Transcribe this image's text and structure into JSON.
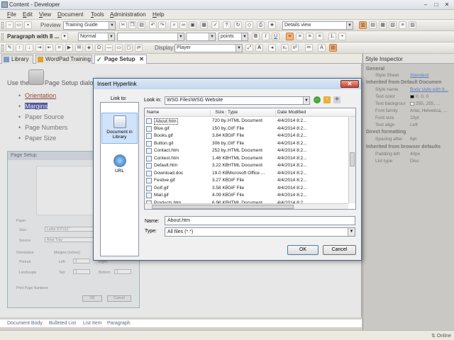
{
  "app": {
    "title": "Content - Developer",
    "window_controls": [
      "–",
      "□",
      "✕"
    ]
  },
  "menu": [
    "File",
    "Edit",
    "View",
    "Document",
    "Tools",
    "Administration",
    "Help"
  ],
  "toolbar1": {
    "preview_label": "Preview",
    "template": "Training Guide",
    "view": "Details view"
  },
  "toolbar2": {
    "style": "Paragraph with 8 ...",
    "font": "Normal",
    "size_units": "points"
  },
  "toolbar3": {
    "display_label": "Display:",
    "display_value": "Player"
  },
  "tabs": [
    {
      "label": "Library"
    },
    {
      "label": "WordPad Training"
    },
    {
      "label": "Page Setup"
    }
  ],
  "document": {
    "intro_left": "Use the",
    "intro_right": "Page Setup dialog",
    "bullets": [
      "Orientation",
      "Margins",
      "Paper Source",
      "Page Numbers",
      "Paper Size"
    ],
    "page_setup": {
      "title": "Page Setup",
      "paper_label": "Paper",
      "size_label": "Size:",
      "size_value": "Letter 8.5\"x11\"",
      "source_label": "Source:",
      "source_value": "Rear Tray",
      "orientation_label": "Orientation",
      "portrait": "Portrait",
      "landscape": "Landscape",
      "margins_label": "Margins (inches)",
      "left": "Left:",
      "right": "Right:",
      "top": "Top:",
      "bottom": "Bottom:",
      "one": "1",
      "print_numbers": "Print Page Numbers",
      "ok": "OK",
      "cancel": "Cancel"
    }
  },
  "breadcrumbs": [
    "Document Body",
    "Bulleted List",
    "List Item",
    "Paragraph"
  ],
  "status": {
    "online": "Online"
  },
  "inspector": {
    "title": "Style Inspector",
    "general": "General",
    "style_sheet_k": "Style Sheet",
    "style_sheet_v": "Standard",
    "inherited_doc": "Inherited from Default Documen",
    "style_name_k": "Style name",
    "style_name_v": "Body style with 8...",
    "text_color_k": "Text color",
    "text_color_v": "0, 0, 0",
    "text_bg_k": "Text backgrour",
    "text_bg_v": "255, 255, ...",
    "font_family_k": "Font family",
    "font_family_v": "Arial, Helvetica, ...",
    "font_size_k": "Font size",
    "font_size_v": "10pt",
    "text_align_k": "Text align",
    "text_align_v": "Left",
    "direct": "Direct formatting",
    "spacing_after_k": "Spacing after",
    "spacing_after_v": "6pt",
    "inherited_browser": "Inherited from browser defaults",
    "padding_left_k": "Padding left",
    "padding_left_v": "40px",
    "list_type_k": "List type",
    "list_type_v": "Disc"
  },
  "dialog": {
    "title": "Insert Hyperlink",
    "close": "✕",
    "link_to": "Link to:",
    "look_in_label": "Look in:",
    "look_in_value": "WSG Files\\WSG Website",
    "places": [
      {
        "label": "Document in Library"
      },
      {
        "label": "URL"
      }
    ],
    "columns": {
      "name": "Name",
      "size": "Size",
      "type": "Type",
      "date": "Date Modified"
    },
    "files": [
      {
        "name": "About.htm",
        "size": "720 by...",
        "type": "HTML Document",
        "date": "4/4/2014 8:2..."
      },
      {
        "name": "Blue.gif",
        "size": "150 by...",
        "type": "GIF File",
        "date": "4/4/2014 8:2..."
      },
      {
        "name": "Books.gif",
        "size": "3.84 KB",
        "type": "GIF File",
        "date": "4/4/2014 8:2..."
      },
      {
        "name": "Button.gif",
        "size": "306 by...",
        "type": "GIF File",
        "date": "4/4/2014 8:2..."
      },
      {
        "name": "Contact.htm",
        "size": "252 by...",
        "type": "HTML Document",
        "date": "4/4/2014 8:2..."
      },
      {
        "name": "Contest.htm",
        "size": "1.46 KB",
        "type": "HTML Document",
        "date": "4/4/2014 8:2..."
      },
      {
        "name": "Default.htm",
        "size": "3.22 KB",
        "type": "HTML Document",
        "date": "4/4/2014 8:2..."
      },
      {
        "name": "Download.doc",
        "size": "19.0 KB",
        "type": "Microsoft Office ...",
        "date": "4/4/2014 8:2..."
      },
      {
        "name": "Festive.gif",
        "size": "3.27 KB",
        "type": "GIF File",
        "date": "4/4/2014 8:2..."
      },
      {
        "name": "Golf.gif",
        "size": "3.58 KB",
        "type": "GIF File",
        "date": "4/4/2014 8:2..."
      },
      {
        "name": "Mail.gif",
        "size": "4.09 KB",
        "type": "GIF File",
        "date": "4/4/2014 8:2..."
      },
      {
        "name": "Products.htm",
        "size": "6.96 KB",
        "type": "HTML Document",
        "date": "4/4/2014 8:2..."
      }
    ],
    "name_label": "Name:",
    "name_value": "About.htm",
    "type_label": "Type:",
    "type_value": "All files (*.*)",
    "ok": "OK",
    "cancel": "Cancel"
  }
}
